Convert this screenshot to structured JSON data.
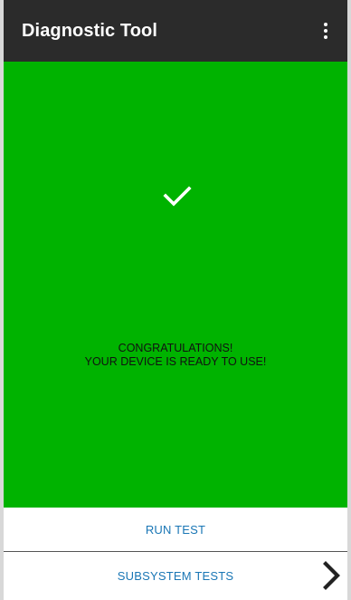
{
  "app_bar": {
    "title": "Diagnostic Tool",
    "menu_icon": "more-vert-icon"
  },
  "result": {
    "background_color": "#00b300",
    "status_icon": "check-icon",
    "message_line_1": "CONGRATULATIONS!",
    "message_line_2": "YOUR DEVICE IS READY TO USE!"
  },
  "actions": {
    "run_test_label": "RUN TEST",
    "subsystem_tests_label": "SUBSYSTEM TESTS",
    "chevron_icon": "chevron-right-icon",
    "accent_color": "#1976b5"
  }
}
